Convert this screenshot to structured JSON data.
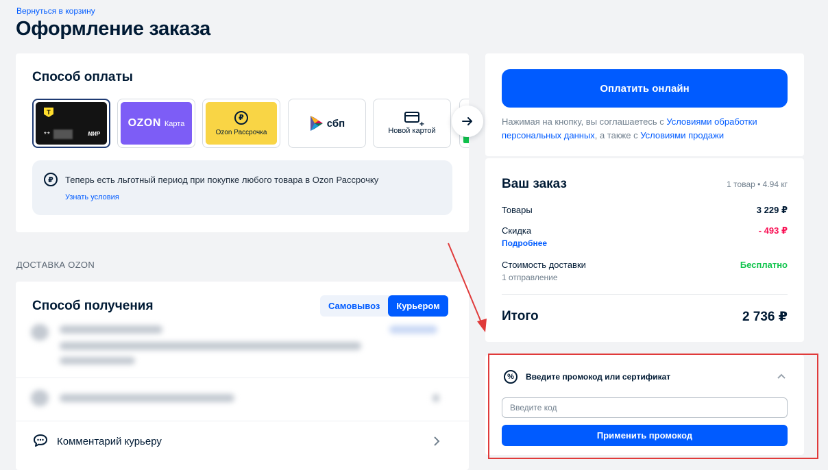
{
  "header": {
    "back_link": "Вернуться в корзину",
    "title": "Оформление заказа"
  },
  "payment": {
    "title": "Способ оплаты",
    "methods": [
      {
        "id": "tbank-card",
        "masked": "**",
        "brand": "МИР"
      },
      {
        "id": "ozon-card",
        "logo": "OZON",
        "label": "Карта"
      },
      {
        "id": "ozon-installment",
        "label": "Ozon Рассрочка"
      },
      {
        "id": "sbp",
        "label": "сбп"
      },
      {
        "id": "new-card",
        "label": "Новой картой"
      }
    ],
    "info_text": "Теперь есть льготный период при покупке любого товара в Ozon Рассрочку",
    "info_link": "Узнать условия"
  },
  "delivery": {
    "section_header": "ДОСТАВКА OZON",
    "title": "Способ получения",
    "toggle_pickup": "Самовывоз",
    "toggle_courier": "Курьером",
    "comment_label": "Комментарий курьеру"
  },
  "checkout": {
    "pay_button": "Оплатить онлайн",
    "agree_prefix": "Нажимая на кнопку, вы соглашаетесь с ",
    "agree_link1": "Условиями обработки персональных данных",
    "agree_middle": ", а также с ",
    "agree_link2": "Условиями продажи"
  },
  "order": {
    "title": "Ваш заказ",
    "meta": "1 товар • 4.94 кг",
    "goods_label": "Товары",
    "goods_value": "3 229 ₽",
    "discount_label": "Скидка",
    "discount_value": "- 493 ₽",
    "discount_link": "Подробнее",
    "shipping_label": "Стоимость доставки",
    "shipping_value": "Бесплатно",
    "shipping_sub": "1 отправление",
    "total_label": "Итого",
    "total_value": "2 736 ₽"
  },
  "promo": {
    "title": "Введите промокод или сертификат",
    "input_placeholder": "Введите код",
    "apply_button": "Применить промокод"
  },
  "colors": {
    "accent": "#005bff",
    "discount": "#f91155",
    "free": "#10c44c",
    "annotation": "#e03a3a"
  }
}
